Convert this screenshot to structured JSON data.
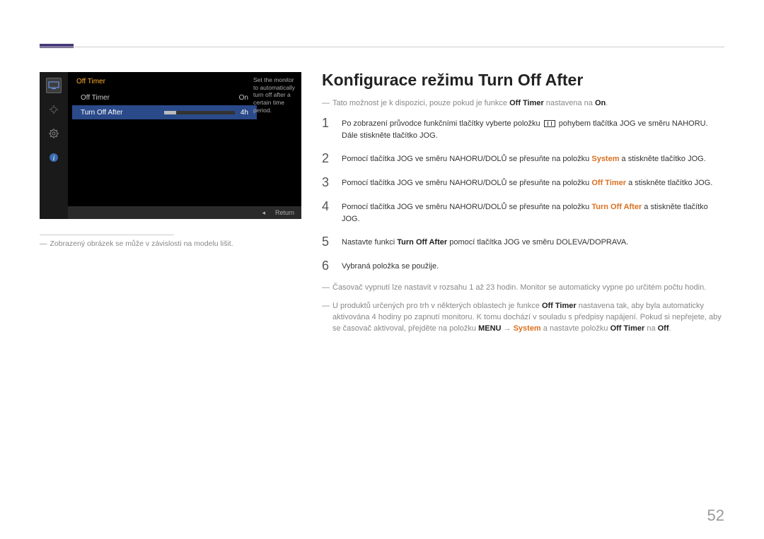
{
  "page_number": "52",
  "osd": {
    "title": "Off Timer",
    "rows": [
      {
        "label": "Off Timer",
        "value": "On"
      },
      {
        "label": "Turn Off After",
        "value": "4h"
      }
    ],
    "help": "Set the monitor to automatically turn off after a certain time period.",
    "footer_back": "◂",
    "footer_return": "Return",
    "icons": {
      "monitor": "monitor",
      "position": "position",
      "settings": "settings",
      "info": "info"
    }
  },
  "caption": "Zobrazený obrázek se může v závislosti na modelu lišit.",
  "heading": "Konfigurace režimu Turn Off After",
  "intro_note": {
    "pre": "Tato možnost je k dispozici, pouze pokud je funkce ",
    "bold1": "Off Timer",
    "mid": " nastavena na ",
    "bold2": "On",
    "post": "."
  },
  "steps": [
    {
      "num": "1",
      "text_pre": "Po zobrazení průvodce funkčními tlačítky vyberte položku ",
      "text_post": " pohybem tlačítka JOG ve směru NAHORU. Dále stiskněte tlačítko JOG."
    },
    {
      "num": "2",
      "text_pre": "Pomocí tlačítka JOG ve směru NAHORU/DOLŮ se přesuňte na položku ",
      "hl": "System",
      "text_post": " a stiskněte tlačítko JOG."
    },
    {
      "num": "3",
      "text_pre": "Pomocí tlačítka JOG ve směru NAHORU/DOLŮ se přesuňte na položku ",
      "hl": "Off Timer",
      "text_post": " a stiskněte tlačítko JOG."
    },
    {
      "num": "4",
      "text_pre": "Pomocí tlačítka JOG ve směru NAHORU/DOLŮ se přesuňte na položku ",
      "hl": "Turn Off After",
      "text_post": " a stiskněte tlačítko JOG."
    },
    {
      "num": "5",
      "text_pre": "Nastavte funkci ",
      "b": "Turn Off After",
      "text_post": " pomocí tlačítka JOG ve směru DOLEVA/DOPRAVA."
    },
    {
      "num": "6",
      "text": "Vybraná položka se použije."
    }
  ],
  "footnotes": [
    {
      "text": "Časovač vypnutí lze nastavit v rozsahu 1 až 23 hodin. Monitor se automaticky vypne po určitém počtu hodin."
    },
    {
      "pre": "U produktů určených pro trh v některých oblastech je funkce ",
      "b1": "Off Timer",
      "mid1": " nastavena tak, aby byla automaticky aktivována 4 hodiny po zapnutí monitoru. K tomu dochází v souladu s předpisy napájení. Pokud si nepřejete, aby se časovač aktivoval, přejděte na položku ",
      "b2": "MENU",
      "arrow": " → ",
      "hl": "System",
      "mid2": " a nastavte položku ",
      "b3": "Off Timer",
      "mid3": " na ",
      "b4": "Off",
      "post": "."
    }
  ]
}
